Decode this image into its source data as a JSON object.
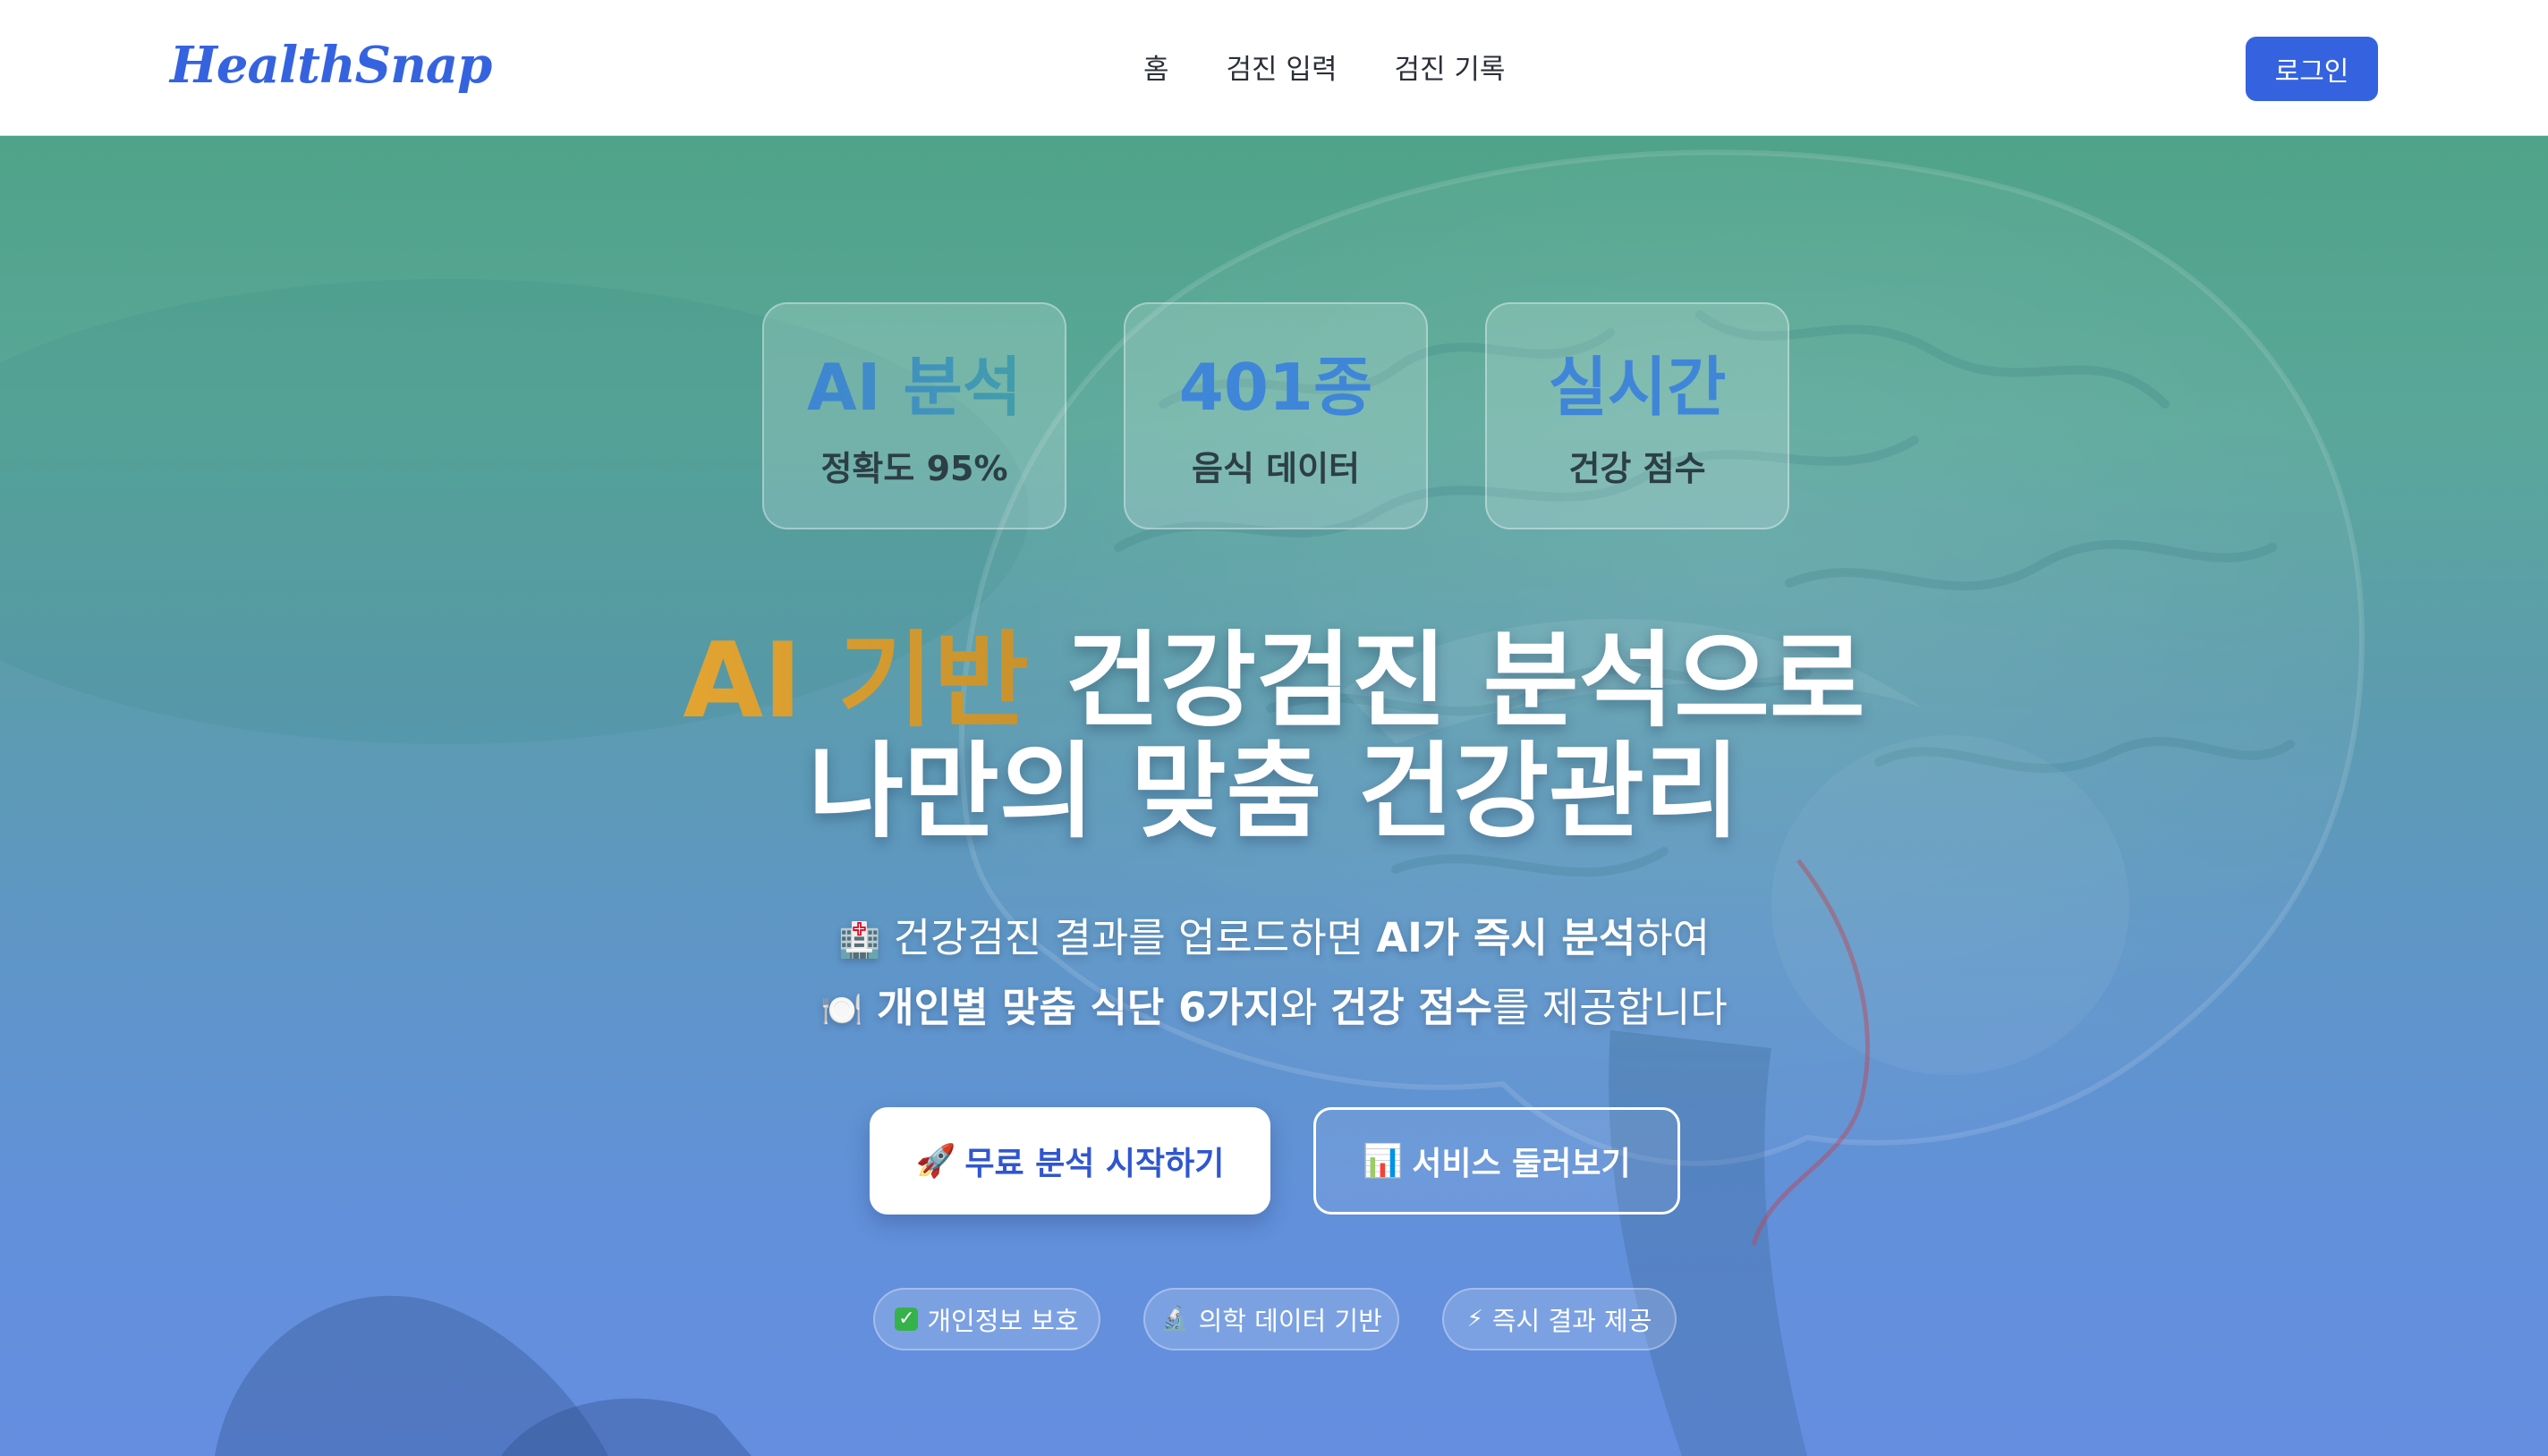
{
  "header": {
    "logo": "HealthSnap",
    "nav": [
      "홈",
      "검진 입력",
      "검진 기록"
    ],
    "login_label": "로그인"
  },
  "stats": [
    {
      "value": "AI 분석",
      "label": "정확도 95%"
    },
    {
      "value": "401종",
      "label": "음식 데이터"
    },
    {
      "value": "실시간",
      "label": "건강 점수"
    }
  ],
  "headline": {
    "line1_accent": "AI 기반",
    "line1_rest": " 건강검진 분석으로",
    "line2": "나만의 맞춤 건강관리"
  },
  "subtext": {
    "line1_emoji": "🏥",
    "line1_a": " 건강검진 결과를 업로드하면 ",
    "line1_bold": "AI가 즉시 분석",
    "line1_b": "하여",
    "line2_emoji": "🍽️",
    "line2_bold1": " 개인별 맞춤 식단 6가지",
    "line2_a": "와 ",
    "line2_bold2": "건강 점수",
    "line2_b": "를 제공합니다"
  },
  "cta": {
    "primary_icon": "🚀",
    "primary_label": "무료 분석 시작하기",
    "secondary_icon": "📊",
    "secondary_label": "서비스 둘러보기"
  },
  "badges": [
    {
      "icon": "✓",
      "label": "개인정보 보호"
    },
    {
      "icon": "🔬",
      "label": "의학 데이터 기반"
    },
    {
      "icon": "⚡",
      "label": "즉시 결과 제공"
    }
  ],
  "colors": {
    "brand": "#3563e0",
    "accent_gold": "#d9a031",
    "hero_top": "#4fa388",
    "hero_bottom": "#658ee0"
  }
}
